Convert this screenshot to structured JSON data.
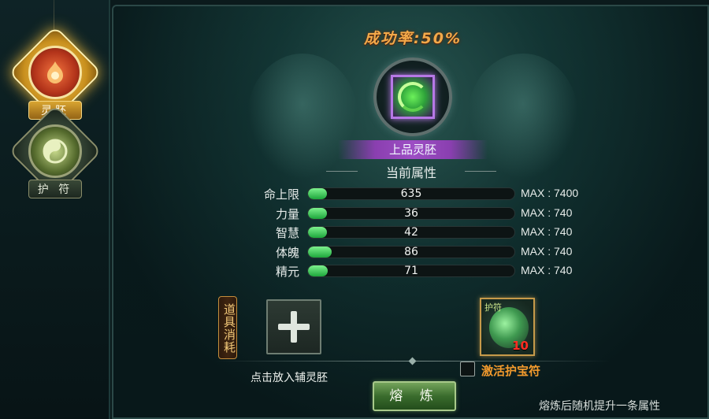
{
  "sidebar": {
    "tabs": [
      {
        "label": "灵胚",
        "icon": "spirit-blank-icon",
        "active": true
      },
      {
        "label": "护 符",
        "icon": "talisman-icon",
        "active": false
      }
    ]
  },
  "forge": {
    "success_rate": "成功率:50%",
    "item_name": "上品灵胚",
    "attributes_title": "当前属性",
    "stats": [
      {
        "label": "命上限",
        "value": "635",
        "max": "MAX : 7400",
        "fraction": 0.086
      },
      {
        "label": "力量",
        "value": "36",
        "max": "MAX : 740",
        "fraction": 0.049
      },
      {
        "label": "智慧",
        "value": "42",
        "max": "MAX : 740",
        "fraction": 0.057
      },
      {
        "label": "体魄",
        "value": "86",
        "max": "MAX : 740",
        "fraction": 0.116
      },
      {
        "label": "精元",
        "value": "71",
        "max": "MAX : 740",
        "fraction": 0.096
      }
    ],
    "consume_label": "道具消耗",
    "add_hint": "点击放入辅灵胚",
    "talisman": {
      "corner_text": "护符",
      "count": "10"
    },
    "activate_label": "激活护宝符",
    "smelt_button": "熔 炼",
    "footer_note": "熔炼后随机提升一条属性"
  },
  "colors": {
    "accent_gold": "#f2a94a",
    "bar_green": "#3ad25a",
    "rare_purple": "#9d4ec4",
    "count_red": "#ff2d22"
  }
}
